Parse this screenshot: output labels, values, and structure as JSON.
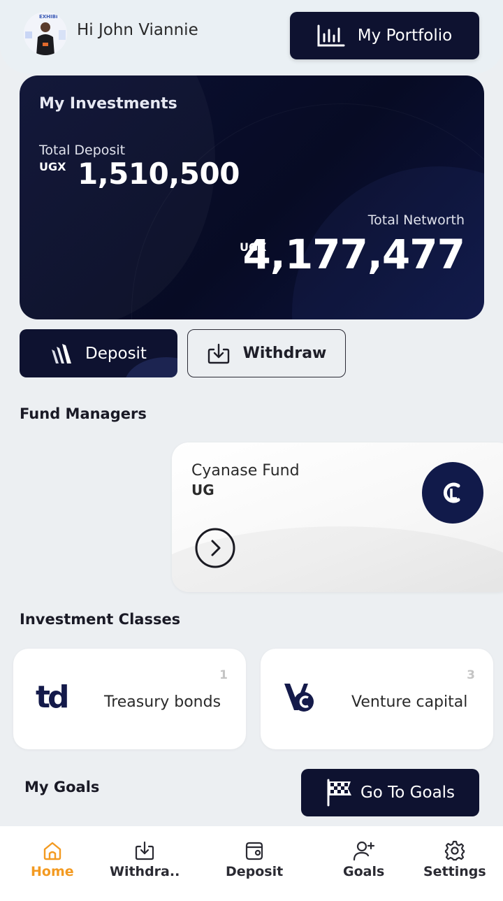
{
  "header": {
    "greeting": "Hi John Viannie",
    "portfolio_label": "My Portfolio",
    "avatar_text": "EXHIBI"
  },
  "investments": {
    "title": "My Investments",
    "total_deposit_label": "Total Deposit",
    "total_deposit_currency": "UGX",
    "total_deposit_value": "1,510,500",
    "total_networth_label": "Total Networth",
    "total_networth_currency": "UGX",
    "total_networth_value": "4,177,477"
  },
  "actions": {
    "deposit_label": "Deposit",
    "withdraw_label": "Withdraw"
  },
  "fund_managers": {
    "title": "Fund Managers",
    "items": [
      {
        "name": "Cyanase Fund",
        "country": "UG"
      }
    ]
  },
  "investment_classes": {
    "title": "Investment Classes",
    "items": [
      {
        "name": "Treasury bonds",
        "count": "1",
        "logo": "td"
      },
      {
        "name": "Venture capital",
        "count": "3",
        "logo": "VC"
      }
    ]
  },
  "goals": {
    "title": "My Goals",
    "button_label": "Go To Goals"
  },
  "bottom_nav": {
    "items": [
      {
        "label": "Home",
        "icon": "home-icon",
        "active": true
      },
      {
        "label": "Withdra..",
        "icon": "withdraw-icon"
      },
      {
        "label": "Deposit",
        "icon": "wallet-icon"
      },
      {
        "label": "Goals",
        "icon": "user-plus-icon"
      },
      {
        "label": "Settings",
        "icon": "gear-icon"
      }
    ]
  },
  "colors": {
    "primary_dark": "#0e1230",
    "accent_active": "#f39a21",
    "background": "#eceff2"
  }
}
